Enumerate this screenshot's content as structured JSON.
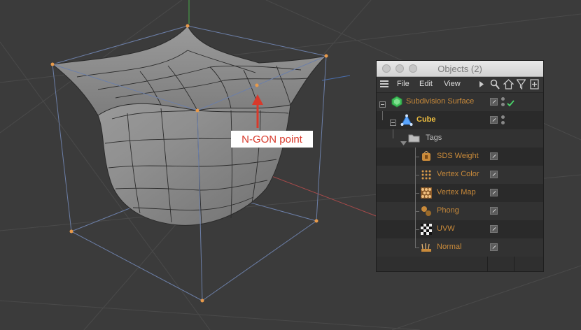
{
  "callout": {
    "text": "N-GON point"
  },
  "object_manager": {
    "title": "Objects (2)",
    "menu": [
      "File",
      "Edit",
      "View"
    ],
    "toolbar_icons": [
      "play-triangle-icon",
      "search-icon",
      "home-icon",
      "filter-icon",
      "add-panel-icon"
    ],
    "rows": [
      {
        "label": "Subdivision Surface",
        "color": "#c98a3a",
        "icon": "subdivision-surface-icon"
      },
      {
        "label": "Cube",
        "color": "#f0c040",
        "icon": "cube-icon"
      },
      {
        "label": "Tags",
        "color": "#bdbdbd",
        "icon": "folder-icon"
      },
      {
        "label": "SDS Weight",
        "color": "#c98a3a",
        "icon": "sds-weight-tag-icon"
      },
      {
        "label": "Vertex Color",
        "color": "#c98a3a",
        "icon": "vertex-color-tag-icon"
      },
      {
        "label": "Vertex Map",
        "color": "#c98a3a",
        "icon": "vertex-map-tag-icon"
      },
      {
        "label": "Phong",
        "color": "#c98a3a",
        "icon": "phong-tag-icon"
      },
      {
        "label": "UVW",
        "color": "#c98a3a",
        "icon": "uvw-tag-icon"
      },
      {
        "label": "Normal",
        "color": "#c98a3a",
        "icon": "normal-tag-icon"
      }
    ]
  },
  "colors": {
    "accent": "#d8392b",
    "viewport": "#3b3b3b",
    "mesh": "#8a8a8a"
  }
}
